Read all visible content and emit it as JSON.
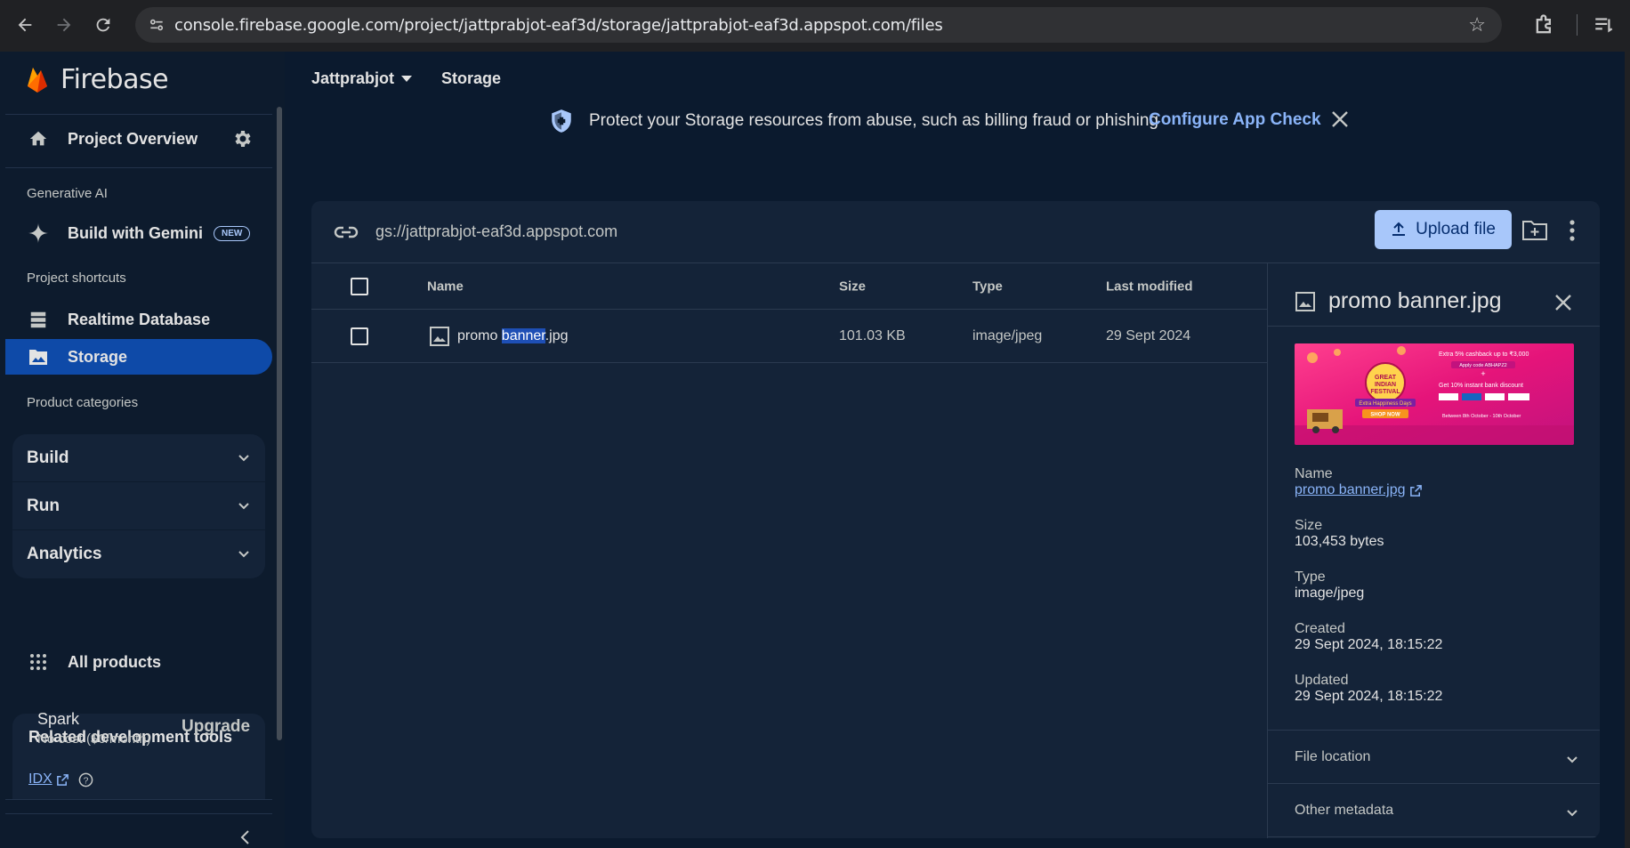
{
  "browser": {
    "url": "console.firebase.google.com/project/jattprabjot-eaf3d/storage/jattprabjot-eaf3d.appspot.com/files"
  },
  "sidebar": {
    "logo_text": "Firebase",
    "project_overview": "Project Overview",
    "generative_ai_label": "Generative AI",
    "build_with_gemini": "Build with Gemini",
    "new_badge": "NEW",
    "project_shortcuts_label": "Project shortcuts",
    "realtime_database": "Realtime Database",
    "storage": "Storage",
    "product_categories_label": "Product categories",
    "categories": [
      "Build",
      "Run",
      "Analytics"
    ],
    "all_products": "All products",
    "related_tools_title": "Related development tools",
    "idx_link": "IDX",
    "plan_name": "Spark",
    "plan_cost": "No cost ($0/month)",
    "upgrade": "Upgrade"
  },
  "header": {
    "project": "Jattprabjot",
    "section": "Storage"
  },
  "banner": {
    "text": "Protect your Storage resources from abuse, such as billing fraud or phishing",
    "link": "Configure App Check"
  },
  "bucket": {
    "path": "gs://jattprabjot-eaf3d.appspot.com",
    "upload_label": "Upload file"
  },
  "table": {
    "columns": [
      "Name",
      "Size",
      "Type",
      "Last modified"
    ],
    "rows": [
      {
        "name_pre": "promo ",
        "name_hl": "banner",
        "name_post": ".jpg",
        "size": "101.03 KB",
        "type": "image/jpeg",
        "modified": "29 Sept 2024"
      }
    ]
  },
  "details": {
    "title": "promo banner.jpg",
    "name_label": "Name",
    "name_value": "promo banner.jpg",
    "size_label": "Size",
    "size_value": "103,453 bytes",
    "type_label": "Type",
    "type_value": "image/jpeg",
    "created_label": "Created",
    "created_value": "29 Sept 2024, 18:15:22",
    "updated_label": "Updated",
    "updated_value": "29 Sept 2024, 18:15:22",
    "file_location": "File location",
    "other_metadata": "Other metadata"
  },
  "thumbnail": {
    "festival_line1": "GREAT",
    "festival_line2": "INDIAN",
    "festival_line3": "FESTIVAL",
    "tag": "Extra Happiness Days",
    "cta": "SHOP NOW",
    "offer1": "Extra 5% cashback up to ₹3,000",
    "offer_code": "Apply code ABHAPZ2",
    "plus": "+",
    "offer2": "Get 10% instant bank discount",
    "dates": "Between 8th October - 10th October"
  },
  "colors": {
    "accent": "#a8c7fa",
    "link": "#8ab4f8",
    "active_nav": "#0e4aa8",
    "background": "#0b1a2e",
    "card": "#142338"
  }
}
